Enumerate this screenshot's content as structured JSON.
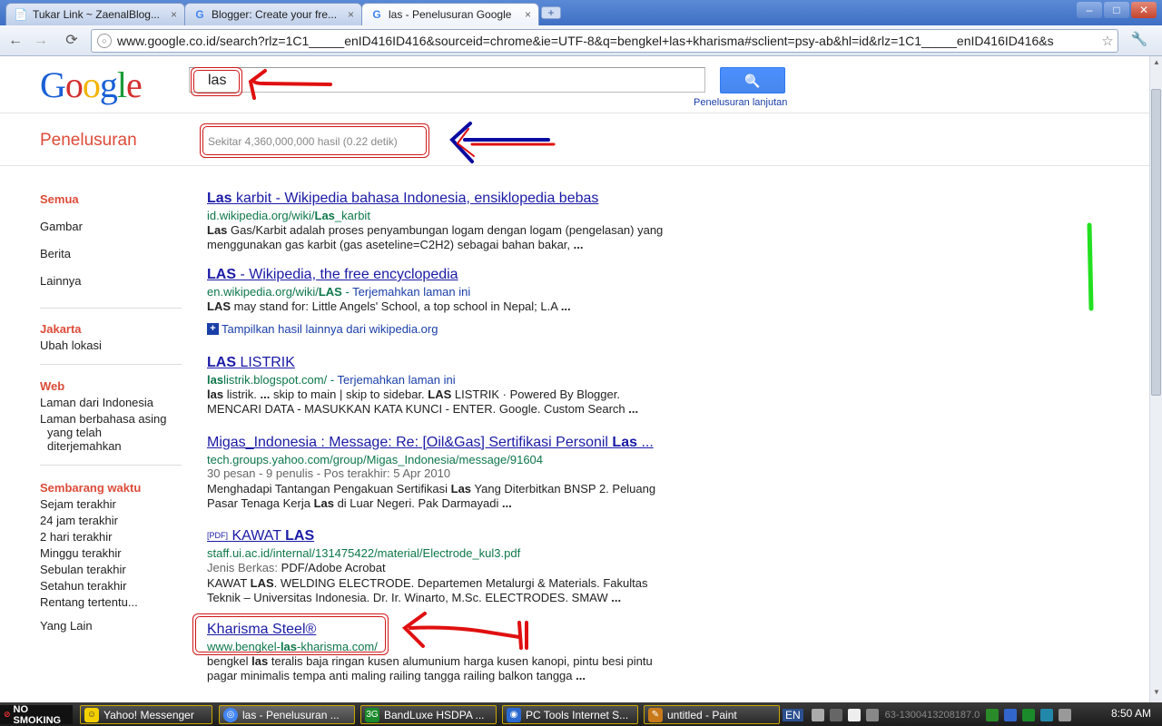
{
  "browser": {
    "tabs": [
      {
        "title": "Tukar Link ~ ZaenalBlog...",
        "icon": "document-icon"
      },
      {
        "title": "Blogger: Create your fre...",
        "icon": "google-favicon"
      },
      {
        "title": "las - Penelusuran Google",
        "icon": "google-favicon"
      }
    ],
    "tab_close": "×",
    "new_tab": "+",
    "window_buttons": {
      "minimize": "–",
      "maximize": "□",
      "close": "✕"
    },
    "nav": {
      "back": "←",
      "forward": "→",
      "reload": "⟳"
    },
    "url": "www.google.co.id/search?rlz=1C1_____enID416ID416&sourceid=chrome&ie=UTF-8&q=bengkel+las+kharisma#sclient=psy-ab&hl=id&rlz=1C1_____enID416ID416&s",
    "bookmark_star": "☆",
    "wrench": "🔧"
  },
  "search": {
    "logo": "Google",
    "query": "las",
    "search_button_icon": "🔍",
    "advanced_link": "Penelusuran lanjutan",
    "page_title": "Penelusuran",
    "stats": "Sekitar 4,360,000,000 hasil (0.22 detik)"
  },
  "sidebar": {
    "types": [
      "Semua",
      "Gambar",
      "Berita",
      "Lainnya"
    ],
    "location_head": "Jakarta",
    "location_link": "Ubah lokasi",
    "web_head": "Web",
    "web_items": [
      "Laman dari Indonesia",
      "Laman berbahasa asing",
      "yang telah",
      "diterjemahkan"
    ],
    "time_head": "Sembarang waktu",
    "time_items": [
      "Sejam terakhir",
      "24 jam terakhir",
      "2 hari terakhir",
      "Minggu terakhir",
      "Sebulan terakhir",
      "Setahun terakhir",
      "Rentang tertentu..."
    ],
    "more": "Yang Lain"
  },
  "results": [
    {
      "title_b": "Las",
      "title_rest": " karbit - Wikipedia bahasa Indonesia, ensiklopedia bebas",
      "url_pre": "id.wikipedia.org/wiki/",
      "url_b": "Las",
      "url_post": "_karbit",
      "s1_b": "Las",
      "s1": " Gas/Karbit adalah proses penyambungan logam dengan logam (pengelasan) yang",
      "s2": "menggunakan gas karbit (gas aseteline=C2H2) sebagai bahan bakar, ",
      "ell": "..."
    },
    {
      "title_b": "LAS",
      "title_rest": " - Wikipedia, the free encyclopedia",
      "url_pre": "en.wikipedia.org/wiki/",
      "url_b": "LAS",
      "url_post": " - ",
      "translate": "Terjemahkan laman ini",
      "s1_b": "LAS",
      "s1": " may stand for: Little Angels' School, a top school in Nepal; L.A ",
      "ell": "..."
    },
    {
      "title_b": "LAS",
      "title_rest": " LISTRIK",
      "url_b": "las",
      "url_post": "listrik.blogspot.com/ - ",
      "translate": "Terjemahkan laman ini",
      "s1_b": "las",
      "s1": " listrik. ",
      "s1_e": "...",
      "s1_c": " skip to main | skip to sidebar. ",
      "s1_b2": "LAS",
      "s1_d": " LISTRIK · Powered By Blogger.",
      "s2": "MENCARI DATA - MASUKKAN KATA KUNCI - ENTER. Google. Custom Search ",
      "ell": "..."
    },
    {
      "title_rest": "Migas_Indonesia : Message: Re: [Oil&Gas] Sertifikasi Personil ",
      "title_b": "Las",
      "title_post": " ...",
      "url_pre": "tech.groups.yahoo.com/group/Migas_Indonesia/message/91604",
      "meta": "30 pesan - 9 penulis - Pos terakhir: 5 Apr 2010",
      "s1": "Menghadapi Tantangan Pengakuan Sertifikasi ",
      "s1_b": "Las",
      "s1_c": " Yang Diterbitkan BNSP 2. Peluang",
      "s2": "Pasar Tenaga Kerja ",
      "s2_b": "Las",
      "s2_c": " di Luar Negeri. Pak Darmayadi ",
      "ell": "..."
    },
    {
      "pdf": "[PDF]",
      "title_rest": "KAWAT ",
      "title_b": "LAS",
      "url_pre": "staff.ui.ac.id/internal/131475422/material/Electrode_kul3.pdf",
      "meta_label": "Jenis Berkas: ",
      "meta_val": "PDF/Adobe Acrobat",
      "s1": "KAWAT ",
      "s1_b": "LAS",
      "s1_c": ". WELDING ELECTRODE. Departemen Metalurgi & Materials. Fakultas",
      "s2": "Teknik – Universitas Indonesia. Dr. Ir. Winarto, M.Sc. ELECTRODES. SMAW ",
      "ell": "..."
    },
    {
      "title_rest": "Kharisma Steel®",
      "url_pre": "www.bengkel-",
      "url_b": "las",
      "url_post": "-kharisma.com/",
      "s1": "bengkel ",
      "s1_b": "las",
      "s1_c": " teralis baja ringan kusen alumunium harga kusen kanopi, pintu besi pintu",
      "s2": "pagar minimalis tempa anti maling railing tangga railing balkon tangga ",
      "ell": "..."
    }
  ],
  "more_results": "Tampilkan hasil lainnya dari wikipedia.org",
  "taskbar": {
    "start": "NO SMOKING",
    "items": [
      "Yahoo! Messenger",
      "las - Penelusuran ...",
      "BandLuxe HSDPA ...",
      "PC Tools Internet S...",
      "untitled - Paint"
    ],
    "lang": "EN",
    "tray_text": "63-1300413208187.0",
    "clock": "8:50 AM"
  },
  "colors": {
    "google_blue": "#1a1aa6",
    "url_green": "#0e774a",
    "accent_red": "#dd4b39",
    "annotation_red": "#e01010",
    "annotation_blue": "#0a0aa0",
    "annotation_green": "#22e020"
  }
}
